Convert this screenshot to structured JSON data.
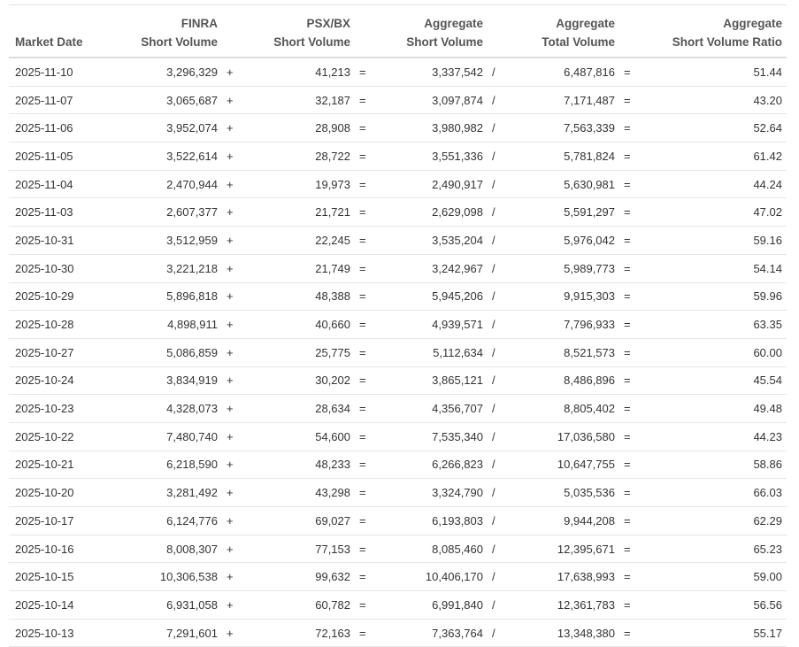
{
  "headers": {
    "date": "Market Date",
    "finra_1": "FINRA",
    "finra_2": "Short Volume",
    "psx_1": "PSX/BX",
    "psx_2": "Short Volume",
    "agg_short_1": "Aggregate",
    "agg_short_2": "Short Volume",
    "agg_total_1": "Aggregate",
    "agg_total_2": "Total Volume",
    "ratio_1": "Aggregate",
    "ratio_2": "Short Volume Ratio"
  },
  "ops": {
    "plus": "+",
    "eq": "=",
    "div": "/"
  },
  "rows": [
    {
      "date": "2025-11-10",
      "finra": "3,296,329",
      "psx": "41,213",
      "agg_short": "3,337,542",
      "agg_total": "6,487,816",
      "ratio": "51.44"
    },
    {
      "date": "2025-11-07",
      "finra": "3,065,687",
      "psx": "32,187",
      "agg_short": "3,097,874",
      "agg_total": "7,171,487",
      "ratio": "43.20"
    },
    {
      "date": "2025-11-06",
      "finra": "3,952,074",
      "psx": "28,908",
      "agg_short": "3,980,982",
      "agg_total": "7,563,339",
      "ratio": "52.64"
    },
    {
      "date": "2025-11-05",
      "finra": "3,522,614",
      "psx": "28,722",
      "agg_short": "3,551,336",
      "agg_total": "5,781,824",
      "ratio": "61.42"
    },
    {
      "date": "2025-11-04",
      "finra": "2,470,944",
      "psx": "19,973",
      "agg_short": "2,490,917",
      "agg_total": "5,630,981",
      "ratio": "44.24"
    },
    {
      "date": "2025-11-03",
      "finra": "2,607,377",
      "psx": "21,721",
      "agg_short": "2,629,098",
      "agg_total": "5,591,297",
      "ratio": "47.02"
    },
    {
      "date": "2025-10-31",
      "finra": "3,512,959",
      "psx": "22,245",
      "agg_short": "3,535,204",
      "agg_total": "5,976,042",
      "ratio": "59.16"
    },
    {
      "date": "2025-10-30",
      "finra": "3,221,218",
      "psx": "21,749",
      "agg_short": "3,242,967",
      "agg_total": "5,989,773",
      "ratio": "54.14"
    },
    {
      "date": "2025-10-29",
      "finra": "5,896,818",
      "psx": "48,388",
      "agg_short": "5,945,206",
      "agg_total": "9,915,303",
      "ratio": "59.96"
    },
    {
      "date": "2025-10-28",
      "finra": "4,898,911",
      "psx": "40,660",
      "agg_short": "4,939,571",
      "agg_total": "7,796,933",
      "ratio": "63.35"
    },
    {
      "date": "2025-10-27",
      "finra": "5,086,859",
      "psx": "25,775",
      "agg_short": "5,112,634",
      "agg_total": "8,521,573",
      "ratio": "60.00"
    },
    {
      "date": "2025-10-24",
      "finra": "3,834,919",
      "psx": "30,202",
      "agg_short": "3,865,121",
      "agg_total": "8,486,896",
      "ratio": "45.54"
    },
    {
      "date": "2025-10-23",
      "finra": "4,328,073",
      "psx": "28,634",
      "agg_short": "4,356,707",
      "agg_total": "8,805,402",
      "ratio": "49.48"
    },
    {
      "date": "2025-10-22",
      "finra": "7,480,740",
      "psx": "54,600",
      "agg_short": "7,535,340",
      "agg_total": "17,036,580",
      "ratio": "44.23"
    },
    {
      "date": "2025-10-21",
      "finra": "6,218,590",
      "psx": "48,233",
      "agg_short": "6,266,823",
      "agg_total": "10,647,755",
      "ratio": "58.86"
    },
    {
      "date": "2025-10-20",
      "finra": "3,281,492",
      "psx": "43,298",
      "agg_short": "3,324,790",
      "agg_total": "5,035,536",
      "ratio": "66.03"
    },
    {
      "date": "2025-10-17",
      "finra": "6,124,776",
      "psx": "69,027",
      "agg_short": "6,193,803",
      "agg_total": "9,944,208",
      "ratio": "62.29"
    },
    {
      "date": "2025-10-16",
      "finra": "8,008,307",
      "psx": "77,153",
      "agg_short": "8,085,460",
      "agg_total": "12,395,671",
      "ratio": "65.23"
    },
    {
      "date": "2025-10-15",
      "finra": "10,306,538",
      "psx": "99,632",
      "agg_short": "10,406,170",
      "agg_total": "17,638,993",
      "ratio": "59.00"
    },
    {
      "date": "2025-10-14",
      "finra": "6,931,058",
      "psx": "60,782",
      "agg_short": "6,991,840",
      "agg_total": "12,361,783",
      "ratio": "56.56"
    },
    {
      "date": "2025-10-13",
      "finra": "7,291,601",
      "psx": "72,163",
      "agg_short": "7,363,764",
      "agg_total": "13,348,380",
      "ratio": "55.17"
    }
  ]
}
